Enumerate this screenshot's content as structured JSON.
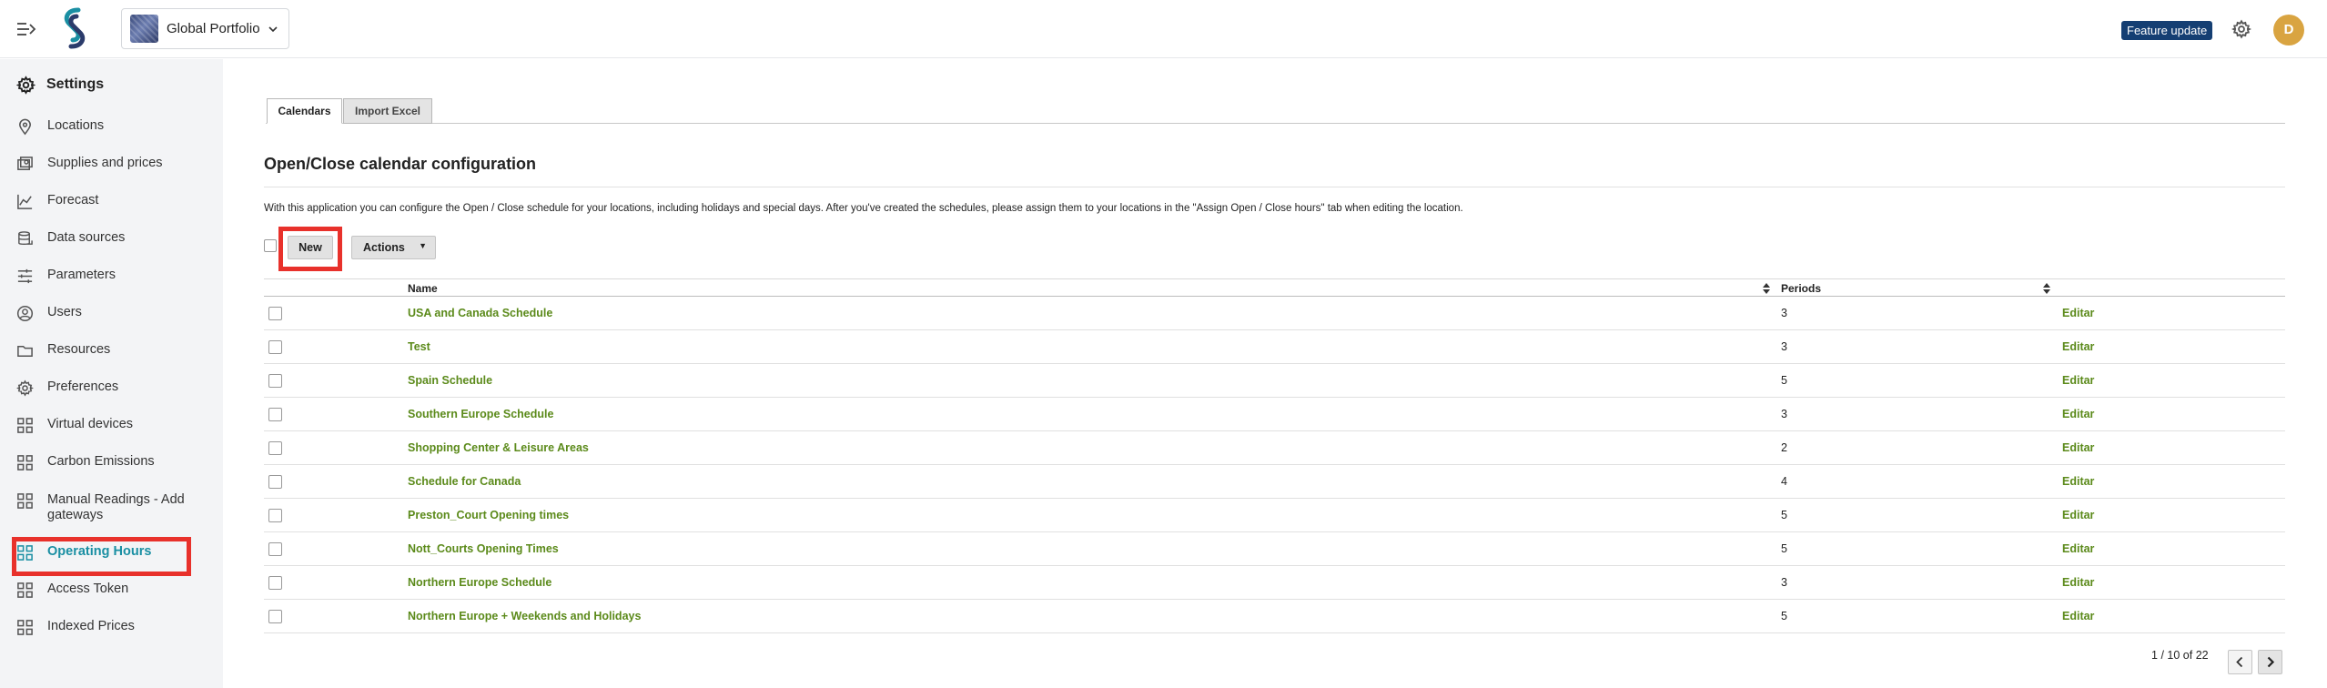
{
  "header": {
    "portfolio_name": "Global Portfolio",
    "feature_badge": "Feature update",
    "avatar_initial": "D",
    "icons": [
      "menu-expand-icon",
      "logo-icon",
      "chevron-down-icon",
      "gear-icon"
    ]
  },
  "sidebar": {
    "title": "Settings",
    "items": [
      {
        "label": "Locations",
        "icon": "location-pin-icon"
      },
      {
        "label": "Supplies and prices",
        "icon": "supplies-icon"
      },
      {
        "label": "Forecast",
        "icon": "chart-icon"
      },
      {
        "label": "Data sources",
        "icon": "database-icon"
      },
      {
        "label": "Parameters",
        "icon": "sliders-icon"
      },
      {
        "label": "Users",
        "icon": "user-circle-icon"
      },
      {
        "label": "Resources",
        "icon": "folder-icon"
      },
      {
        "label": "Preferences",
        "icon": "gear-icon"
      },
      {
        "label": "Virtual devices",
        "icon": "grid-icon"
      },
      {
        "label": "Carbon Emissions",
        "icon": "grid-icon"
      },
      {
        "label": "Manual Readings - Add gateways",
        "icon": "grid-icon"
      },
      {
        "label": "Operating Hours",
        "icon": "grid-icon",
        "active": true
      },
      {
        "label": "Access Token",
        "icon": "grid-icon"
      },
      {
        "label": "Indexed Prices",
        "icon": "grid-icon"
      }
    ]
  },
  "tabs": [
    {
      "label": "Calendars",
      "active": true
    },
    {
      "label": "Import Excel",
      "active": false
    }
  ],
  "main": {
    "title": "Open/Close calendar configuration",
    "description": "With this application you can configure the Open / Close schedule for your locations, including holidays and special days. After you've created the schedules, please assign them to your locations in the \"Assign Open / Close hours\" tab when editing the location.",
    "new_label": "New",
    "actions_label": "Actions",
    "actions_caret": "▼"
  },
  "table": {
    "columns": [
      "Name",
      "Periods"
    ],
    "edit_label": "Editar",
    "rows": [
      {
        "name": "USA and Canada Schedule",
        "periods": "3"
      },
      {
        "name": "Test",
        "periods": "3"
      },
      {
        "name": "Spain Schedule",
        "periods": "5"
      },
      {
        "name": "Southern Europe Schedule",
        "periods": "3"
      },
      {
        "name": "Shopping Center & Leisure Areas",
        "periods": "2"
      },
      {
        "name": "Schedule for Canada",
        "periods": "4"
      },
      {
        "name": "Preston_Court Opening times",
        "periods": "5"
      },
      {
        "name": "Nott_Courts Opening Times",
        "periods": "5"
      },
      {
        "name": "Northern Europe Schedule",
        "periods": "3"
      },
      {
        "name": "Northern Europe + Weekends and Holidays",
        "periods": "5"
      }
    ]
  },
  "pagination": {
    "current": "1",
    "separator": "/",
    "page_size": "10",
    "of_label": "of",
    "total": "22"
  },
  "colors": {
    "accent": "#1a8fa3",
    "link": "#5b8a1a",
    "badge": "#153f73",
    "highlight": "#e8312b",
    "avatar": "#d9a441"
  }
}
